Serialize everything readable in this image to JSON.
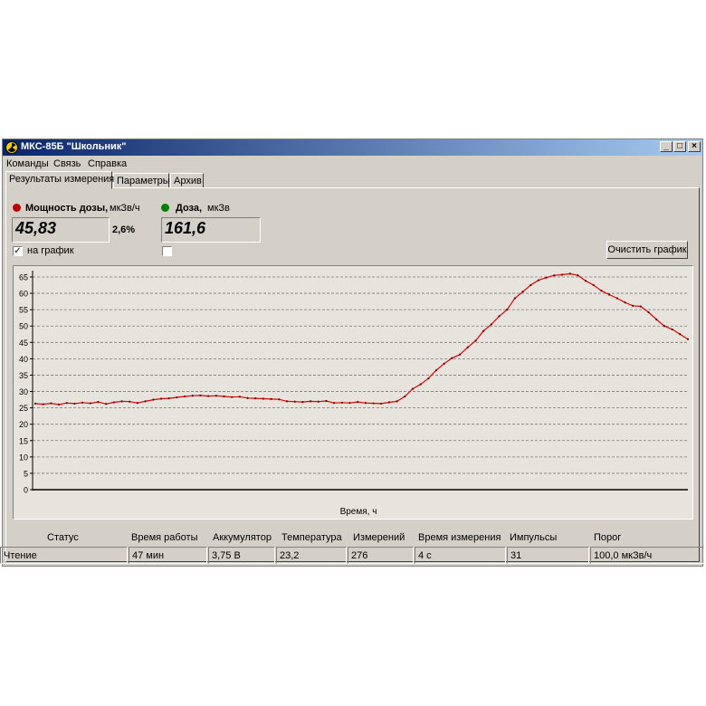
{
  "window": {
    "title": "МКС-85Б \"Школьник\"",
    "buttons": {
      "minimize": "_",
      "maximize": "□",
      "close": "×"
    }
  },
  "menu": [
    "Команды",
    "Связь",
    "Справка"
  ],
  "tabs": [
    "Результаты измерения",
    "Параметры",
    "Архив"
  ],
  "active_tab": 0,
  "dose_rate": {
    "label_bold": "Мощность дозы,",
    "label_unit": "мкЗв/ч",
    "value": "45,83",
    "error": "2,6%",
    "indicator_color": "#c00000",
    "checkbox_label": "на график",
    "checked": true
  },
  "dose": {
    "label_bold": "Доза,",
    "label_unit": "мкЗв",
    "value": "161,6",
    "indicator_color": "#008000",
    "checked": false
  },
  "clear_button": "Очистить график",
  "chart_data": {
    "type": "line",
    "xlabel": "Время, ч",
    "ylabel": "",
    "ylim": [
      0,
      65
    ],
    "yticks": [
      0,
      5,
      10,
      15,
      20,
      25,
      30,
      35,
      40,
      45,
      50,
      55,
      60,
      65
    ],
    "grid": "horizontal dashed",
    "line_color": "#e00000",
    "series": [
      {
        "values": [
          26.3,
          26.1,
          26.4,
          26.0,
          26.5,
          26.3,
          26.6,
          26.4,
          26.8,
          26.2,
          26.7,
          27.0,
          26.9,
          26.5,
          27.0,
          27.5,
          27.8,
          27.9,
          28.2,
          28.5,
          28.7,
          28.8,
          28.6,
          28.7,
          28.5,
          28.3,
          28.4,
          28.0,
          27.9,
          27.8,
          27.7,
          27.6,
          27.0,
          26.9,
          26.8,
          27.0,
          26.9,
          27.1,
          26.5,
          26.6,
          26.5,
          26.8,
          26.5,
          26.4,
          26.3,
          26.7,
          27.0,
          28.5,
          30.8,
          32.2,
          34.0,
          36.5,
          38.5,
          40.2,
          41.3,
          43.5,
          45.5,
          48.5,
          50.5,
          53.0,
          55.0,
          58.5,
          60.5,
          62.5,
          64.0,
          64.8,
          65.5,
          65.7,
          66.0,
          65.5,
          63.8,
          62.5,
          60.8,
          59.6,
          58.5,
          57.2,
          56.2,
          56.0,
          54.2,
          52.0,
          50.0,
          49.0,
          47.5,
          46.0
        ]
      }
    ]
  },
  "status_bar": {
    "headers": [
      "Статус",
      "Время работы",
      "Аккумулятор",
      "Температура",
      "Измерений",
      "Время измерения",
      "Импульсы",
      "Порог"
    ],
    "values": [
      "Чтение",
      "47 мин",
      "3,75 В",
      "23,2",
      "276",
      "4 с",
      "31",
      "100,0 мкЗв/ч"
    ]
  }
}
